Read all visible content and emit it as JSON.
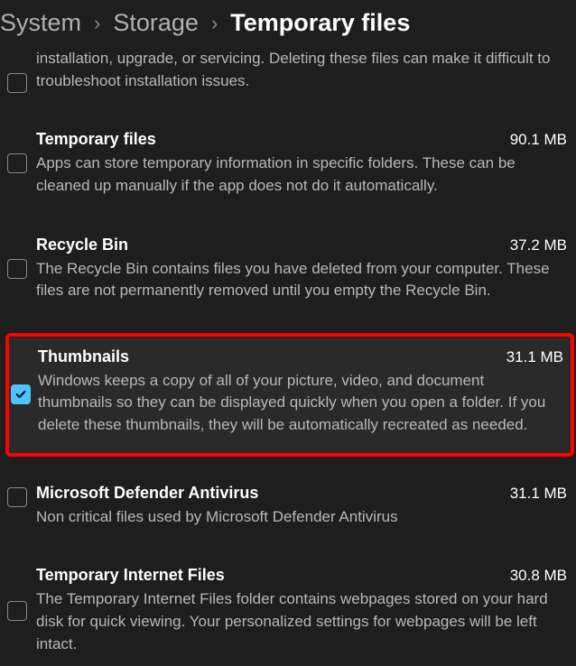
{
  "breadcrumb": {
    "items": [
      "System",
      "Storage",
      "Temporary files"
    ]
  },
  "partial": {
    "desc": "installation, upgrade, or servicing.  Deleting these files can make it difficult to troubleshoot installation issues."
  },
  "items": [
    {
      "title": "Temporary files",
      "size": "90.1 MB",
      "desc": "Apps can store temporary information in specific folders. These can be cleaned up manually if the app does not do it automatically.",
      "checked": false,
      "highlighted": false
    },
    {
      "title": "Recycle Bin",
      "size": "37.2 MB",
      "desc": "The Recycle Bin contains files you have deleted from your computer. These files are not permanently removed until you empty the Recycle Bin.",
      "checked": false,
      "highlighted": false
    },
    {
      "title": "Thumbnails",
      "size": "31.1 MB",
      "desc": "Windows keeps a copy of all of your picture, video, and document thumbnails so they can be displayed quickly when you open a folder. If you delete these thumbnails, they will be automatically recreated as needed.",
      "checked": true,
      "highlighted": true
    },
    {
      "title": "Microsoft Defender Antivirus",
      "size": "31.1 MB",
      "desc": "Non critical files used by Microsoft Defender Antivirus",
      "checked": false,
      "highlighted": false
    },
    {
      "title": "Temporary Internet Files",
      "size": "30.8 MB",
      "desc": "The Temporary Internet Files folder contains webpages stored on your hard disk for quick viewing. Your personalized settings for webpages will be left intact.",
      "checked": false,
      "highlighted": false
    }
  ]
}
